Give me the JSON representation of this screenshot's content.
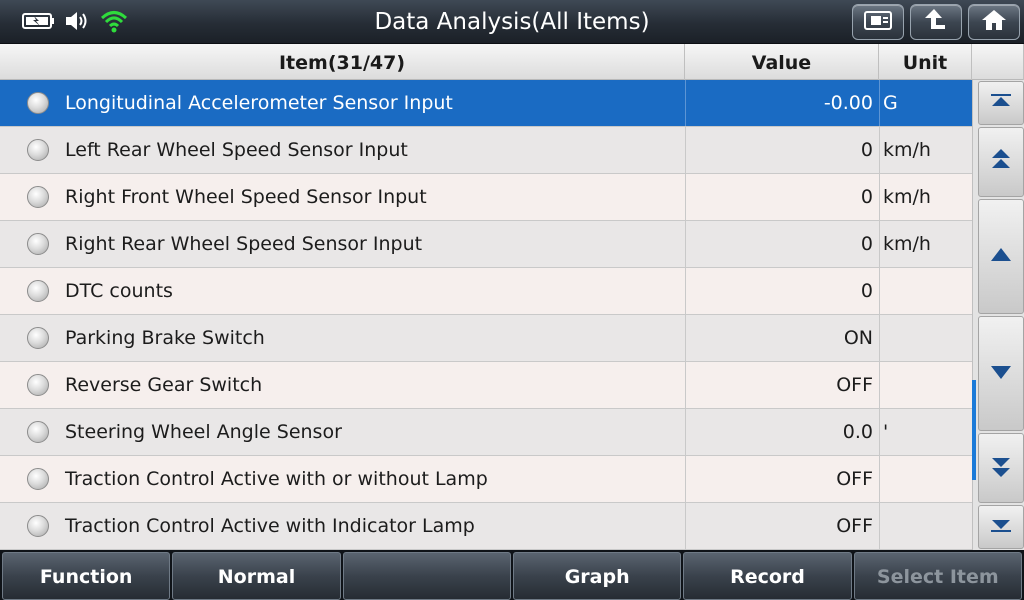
{
  "header": {
    "title": "Data Analysis(All Items)",
    "status_icons": [
      "battery-icon",
      "volume-icon",
      "wifi-icon"
    ],
    "nav_buttons": [
      {
        "name": "screenshot-icon"
      },
      {
        "name": "back-icon"
      },
      {
        "name": "home-icon"
      }
    ]
  },
  "table": {
    "columns": {
      "item": "Item(31/47)",
      "value": "Value",
      "unit": "Unit"
    },
    "rows": [
      {
        "name": "Longitudinal Accelerometer Sensor Input",
        "value": "-0.00",
        "unit": "G",
        "selected": true
      },
      {
        "name": "Left Rear Wheel Speed Sensor Input",
        "value": "0",
        "unit": "km/h"
      },
      {
        "name": "Right Front Wheel Speed Sensor Input",
        "value": "0",
        "unit": "km/h"
      },
      {
        "name": "Right Rear Wheel Speed Sensor Input",
        "value": "0",
        "unit": "km/h"
      },
      {
        "name": "DTC counts",
        "value": "0",
        "unit": ""
      },
      {
        "name": "Parking Brake Switch",
        "value": "ON",
        "unit": ""
      },
      {
        "name": "Reverse Gear Switch",
        "value": "OFF",
        "unit": ""
      },
      {
        "name": "Steering Wheel Angle Sensor",
        "value": "0.0",
        "unit": "'"
      },
      {
        "name": "Traction Control Active with or without Lamp",
        "value": "OFF",
        "unit": ""
      },
      {
        "name": "Traction Control Active with Indicator Lamp",
        "value": "OFF",
        "unit": ""
      }
    ]
  },
  "scroll_buttons": [
    "scroll-top-icon",
    "page-up-icon",
    "line-up-icon",
    "line-down-icon",
    "page-down-icon",
    "scroll-bottom-icon"
  ],
  "toolbar": {
    "buttons": [
      {
        "label": "Function",
        "enabled": true
      },
      {
        "label": "Normal",
        "enabled": true
      },
      {
        "label": "",
        "enabled": true
      },
      {
        "label": "Graph",
        "enabled": true
      },
      {
        "label": "Record",
        "enabled": true
      },
      {
        "label": "Select Item",
        "enabled": false
      }
    ]
  },
  "colors": {
    "selected_row": "#1a6bc3",
    "scroll_thumb": "#1b7ad8",
    "wifi": "#2fdc3c"
  }
}
